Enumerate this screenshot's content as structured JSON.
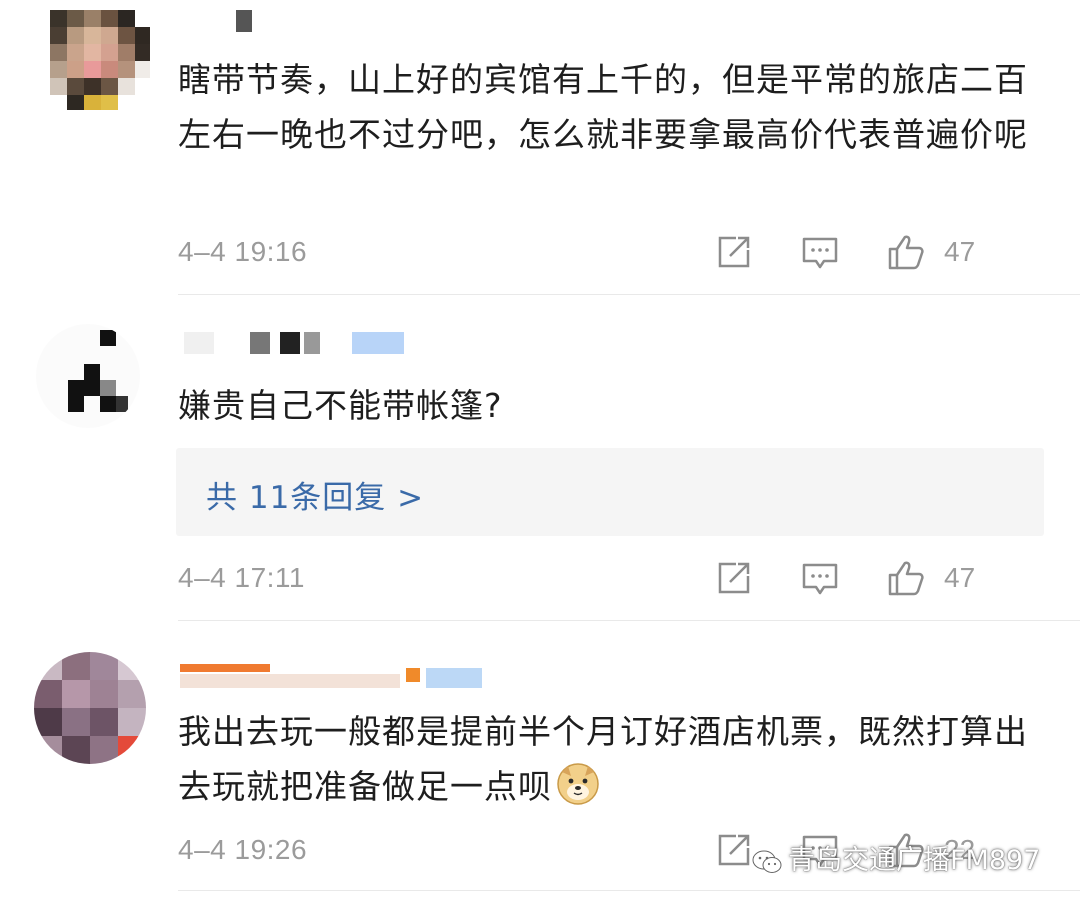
{
  "comments": [
    {
      "text": "瞎带节奏，山上好的宾馆有上千的，但是平常的旅店二百左右一晚也不过分吧，怎么就非要拿最高价代表普遍价呢",
      "time": "4–4 19:16",
      "likes": "47"
    },
    {
      "text": "嫌贵自己不能带帐篷?",
      "replies_label": "共 11条回复 >",
      "time": "4–4 17:11",
      "likes": "47"
    },
    {
      "text": "我出去玩一般都是提前半个月订好酒店机票，既然打算出去玩就把准备做足一点呗",
      "time": "4–4 19:26",
      "likes": "22"
    }
  ],
  "watermark": "青岛交通广播FM897",
  "icons": {
    "repost": "share-edit-icon",
    "comment": "comment-icon",
    "like": "thumbs-up-icon",
    "emoji": "doge-emoji-icon",
    "watermark": "wechat-icon"
  },
  "colors": {
    "link": "#3a6aa8",
    "meta": "#9b9b9b",
    "reply_bg": "#f5f5f5"
  }
}
